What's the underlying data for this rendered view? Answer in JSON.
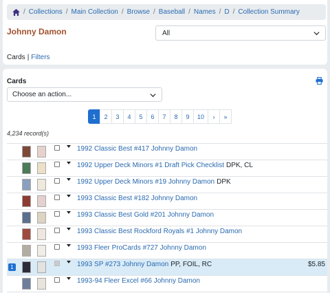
{
  "breadcrumb": [
    "Collections",
    "Main Collection",
    "Browse",
    "Baseball",
    "Names",
    "D",
    "Collection Summary"
  ],
  "player_name": "Johnny Damon",
  "view_select": "All",
  "sub_links": {
    "cards": "Cards",
    "filters": "Filters"
  },
  "cards_section": {
    "title": "Cards",
    "action_placeholder": "Choose an action..."
  },
  "pagination": {
    "pages": [
      "1",
      "2",
      "3",
      "4",
      "5",
      "6",
      "7",
      "8",
      "9",
      "10"
    ],
    "next": "›",
    "last": "»",
    "current": "1"
  },
  "records": "4,234 record(s)",
  "rows": [
    {
      "title": "1992 Classic Best #417 Johnny Damon",
      "attrs": "",
      "price": "",
      "qty": "",
      "front": "#7d4a3a",
      "back": "#e6d2cc"
    },
    {
      "title": "1992 Upper Deck Minors #1 Draft Pick Checklist",
      "attrs": "DPK, CL",
      "price": "",
      "qty": "",
      "front": "#4d7a57",
      "back": "#ece0c8"
    },
    {
      "title": "1992 Upper Deck Minors #19 Johnny Damon",
      "attrs": "DPK",
      "price": "",
      "qty": "",
      "front": "#8aa0be",
      "back": "#efe8dc"
    },
    {
      "title": "1993 Classic Best #182 Johnny Damon",
      "attrs": "",
      "price": "",
      "qty": "",
      "front": "#8c3c33",
      "back": "#e4d0cf"
    },
    {
      "title": "1993 Classic Best Gold #201 Johnny Damon",
      "attrs": "",
      "price": "",
      "qty": "",
      "front": "#5b6f8e",
      "back": "#ddd3c2"
    },
    {
      "title": "1993 Classic Best Rockford Royals #1 Johnny Damon",
      "attrs": "",
      "price": "",
      "qty": "",
      "front": "#9e4a3f",
      "back": "#efe6e0"
    },
    {
      "title": "1993 Fleer ProCards #727 Johnny Damon",
      "attrs": "",
      "price": "",
      "qty": "",
      "front": "#b4ada4",
      "back": "#f0ece6"
    },
    {
      "title": "1993 SP #273 Johnny Damon",
      "attrs": "PP, FOIL, RC",
      "price": "$5.85",
      "qty": "1",
      "front": "#2b2b3a",
      "back": "#e2e2e2"
    },
    {
      "title": "1993-94 Fleer Excel #66 Johnny Damon",
      "attrs": "",
      "price": "",
      "qty": "",
      "front": "#6e7f9c",
      "back": "#e8e4dc"
    }
  ],
  "colors": {
    "accent": "#1f6fd0",
    "name": "#a0522d",
    "link": "#2a6ab0",
    "row_highlight": "#d9ebf7"
  }
}
